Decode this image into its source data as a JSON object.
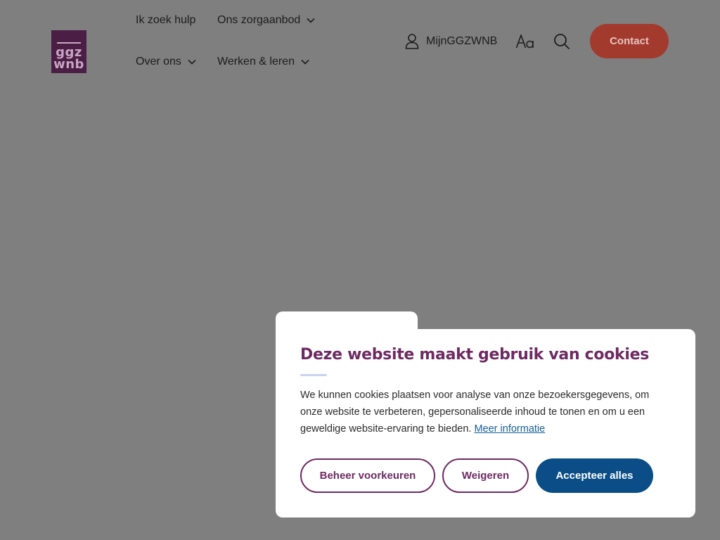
{
  "colors": {
    "overlay": "#7f7f7f",
    "brand_purple": "#6e2a63",
    "logo_bg": "#4a1e45",
    "contact_red": "#a33a2e",
    "primary_blue": "#0b4d86",
    "link_blue": "#155e96"
  },
  "header": {
    "logo": {
      "line1": "ggz",
      "line2": "wnb"
    },
    "nav": [
      {
        "label": "Ik zoek hulp",
        "has_dropdown": false
      },
      {
        "label": "Ons zorgaanbod",
        "has_dropdown": true
      },
      {
        "label": "Over ons",
        "has_dropdown": true
      },
      {
        "label": "Werken & leren",
        "has_dropdown": true
      }
    ],
    "account_label": "MijnGGZWNB",
    "icons": [
      "user-icon",
      "font-size-icon",
      "search-icon",
      "chevron-down-icon"
    ],
    "contact_label": "Contact"
  },
  "cookie_dialog": {
    "title": "Deze website maakt gebruik van cookies",
    "body": "We kunnen cookies plaatsen voor analyse van onze bezoekersgegevens, om onze website te verbeteren, gepersonaliseerde inhoud te tonen en om u een geweldige website-ervaring te bieden.",
    "more_info_link": "Meer informatie",
    "buttons": {
      "manage": "Beheer voorkeuren",
      "reject": "Weigeren",
      "accept": "Accepteer alles"
    }
  }
}
